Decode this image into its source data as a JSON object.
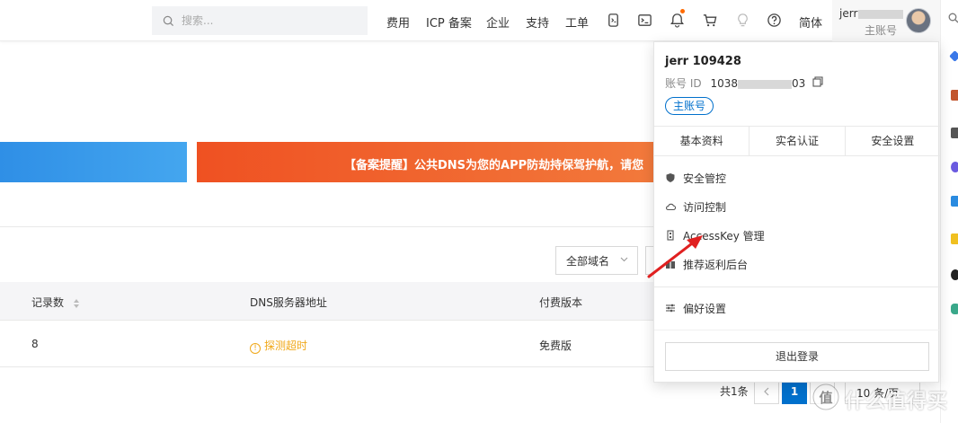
{
  "nav": {
    "search_placeholder": "搜索...",
    "links": [
      "费用",
      "ICP 备案",
      "企业",
      "支持",
      "工单"
    ],
    "language": "简体",
    "notification_dot_color": "#ff6a00",
    "user": {
      "name_prefix": "jerr",
      "role": "主账号"
    }
  },
  "banner": {
    "text": "【备案提醒】公共DNS为您的APP防劫持保驾护航，请您"
  },
  "filter": {
    "domain_select": "全部域名"
  },
  "table": {
    "headers": [
      "记录数",
      "DNS服务器地址",
      "付费版本"
    ],
    "rows": [
      {
        "records": "8",
        "dns_status": "探测超时",
        "plan": "免费版"
      }
    ]
  },
  "pagination": {
    "total": "共1条",
    "current_page": "1",
    "page_size": "10 条/页"
  },
  "dropdown": {
    "username": "jerr 109428",
    "account_id_label": "账号 ID",
    "account_id_start": "1038",
    "account_id_end": "03",
    "badge": "主账号",
    "tabs": [
      "基本资料",
      "实名认证",
      "安全设置"
    ],
    "menu": [
      "安全管控",
      "访问控制",
      "AccessKey 管理",
      "推荐返利后台",
      "偏好设置"
    ],
    "logout": "退出登录"
  },
  "watermark": {
    "text": "值 什么值得买"
  },
  "colors": {
    "brand_blue": "#0070cc",
    "banner_orange": "#ef5122",
    "banner_blue": "#2f8fe6",
    "warn": "#f0a81a",
    "arrow_red": "#e02020"
  }
}
